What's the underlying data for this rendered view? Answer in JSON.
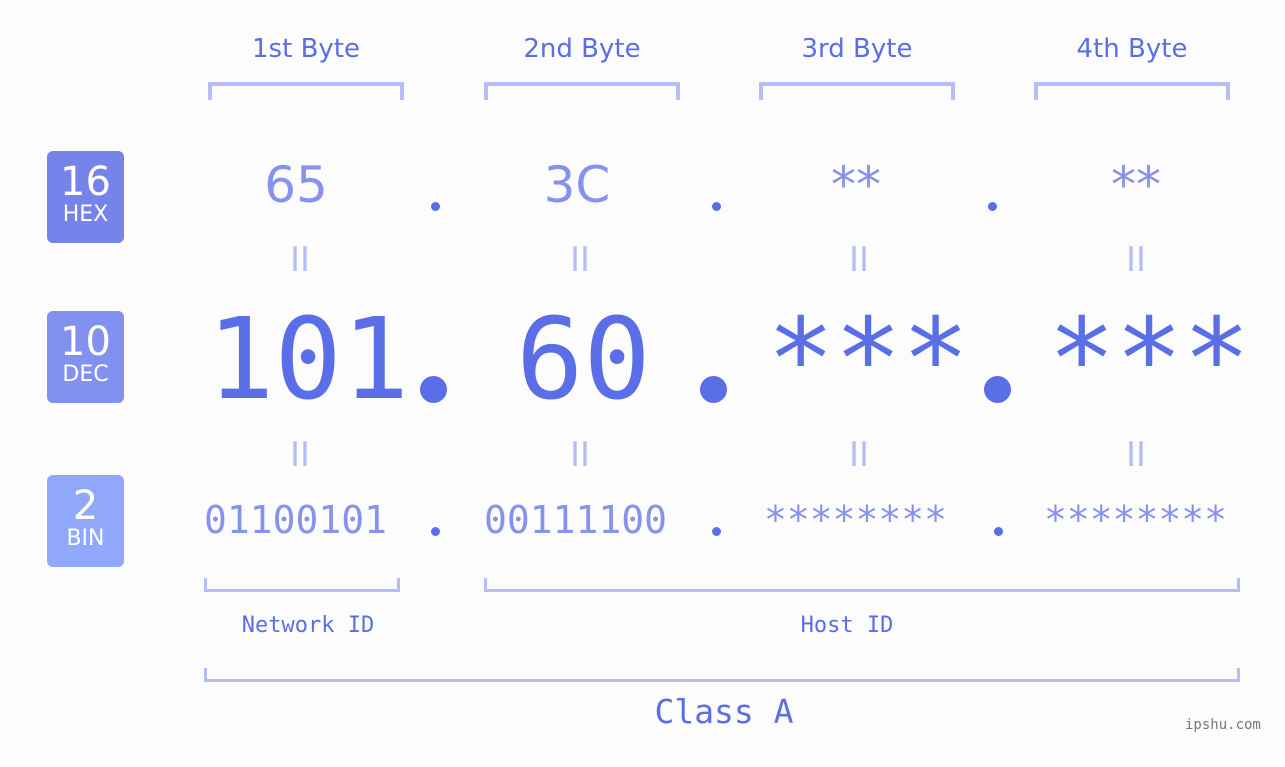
{
  "headers": [
    "1st Byte",
    "2nd Byte",
    "3rd Byte",
    "4th Byte"
  ],
  "badges": [
    {
      "num": "16",
      "label": "HEX",
      "color": "#7683ea"
    },
    {
      "num": "10",
      "label": "DEC",
      "color": "#8291f0"
    },
    {
      "num": "2",
      "label": "BIN",
      "color": "#8fa8f9"
    }
  ],
  "hex": [
    "65",
    "3C",
    "**",
    "**"
  ],
  "dec": [
    "101",
    "60",
    "***",
    "***"
  ],
  "bin": [
    "01100101",
    "00111100",
    "********",
    "********"
  ],
  "separator": ".",
  "equals": "II",
  "labels": {
    "network": "Network ID",
    "host": "Host ID",
    "class": "Class A"
  },
  "watermark": "ipshu.com"
}
